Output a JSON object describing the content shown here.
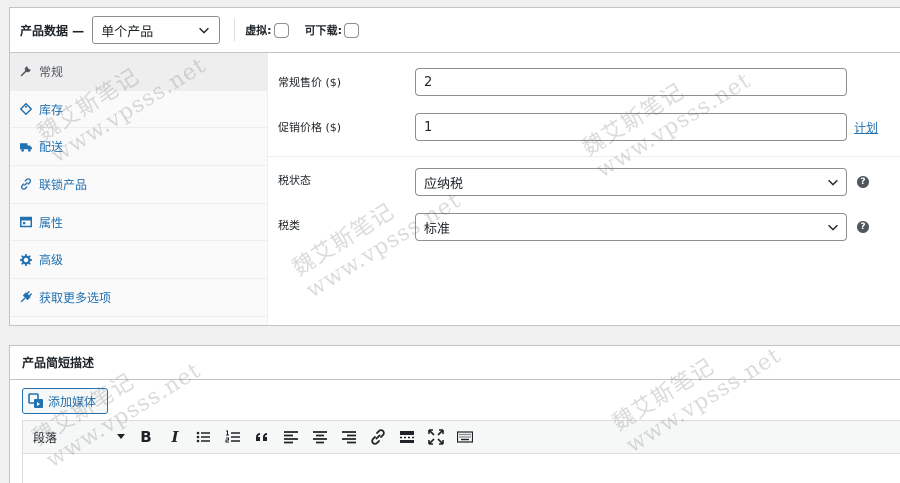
{
  "product_data": {
    "title": "产品数据 —",
    "type_selected": "单个产品",
    "virtual_label": "虚拟:",
    "downloadable_label": "可下载:",
    "tabs": [
      {
        "label": "常规",
        "icon": "wrench-icon"
      },
      {
        "label": "库存",
        "icon": "tag-icon"
      },
      {
        "label": "配送",
        "icon": "truck-icon"
      },
      {
        "label": "联锁产品",
        "icon": "link-icon"
      },
      {
        "label": "属性",
        "icon": "table-icon"
      },
      {
        "label": "高级",
        "icon": "gear-icon"
      },
      {
        "label": "获取更多选项",
        "icon": "plugin-icon"
      }
    ],
    "general": {
      "regular_price_label": "常规售价 ($)",
      "regular_price_value": "2",
      "sale_price_label": "促销价格 ($)",
      "sale_price_value": "1",
      "schedule_link": "计划",
      "tax_status_label": "税状态",
      "tax_status_value": "应纳税",
      "tax_class_label": "税类",
      "tax_class_value": "标准",
      "help_glyph": "?"
    }
  },
  "short_description": {
    "title": "产品简短描述",
    "add_media_label": "添加媒体",
    "format_selected": "段落",
    "toolbar": {
      "bold": "B",
      "italic": "I"
    }
  },
  "watermark": {
    "line1": "魏艾斯笔记",
    "line2": "www.vpsss.net"
  },
  "colors": {
    "link": "#2271b1",
    "border": "#c3c4c7",
    "background": "#f0f0f1"
  }
}
